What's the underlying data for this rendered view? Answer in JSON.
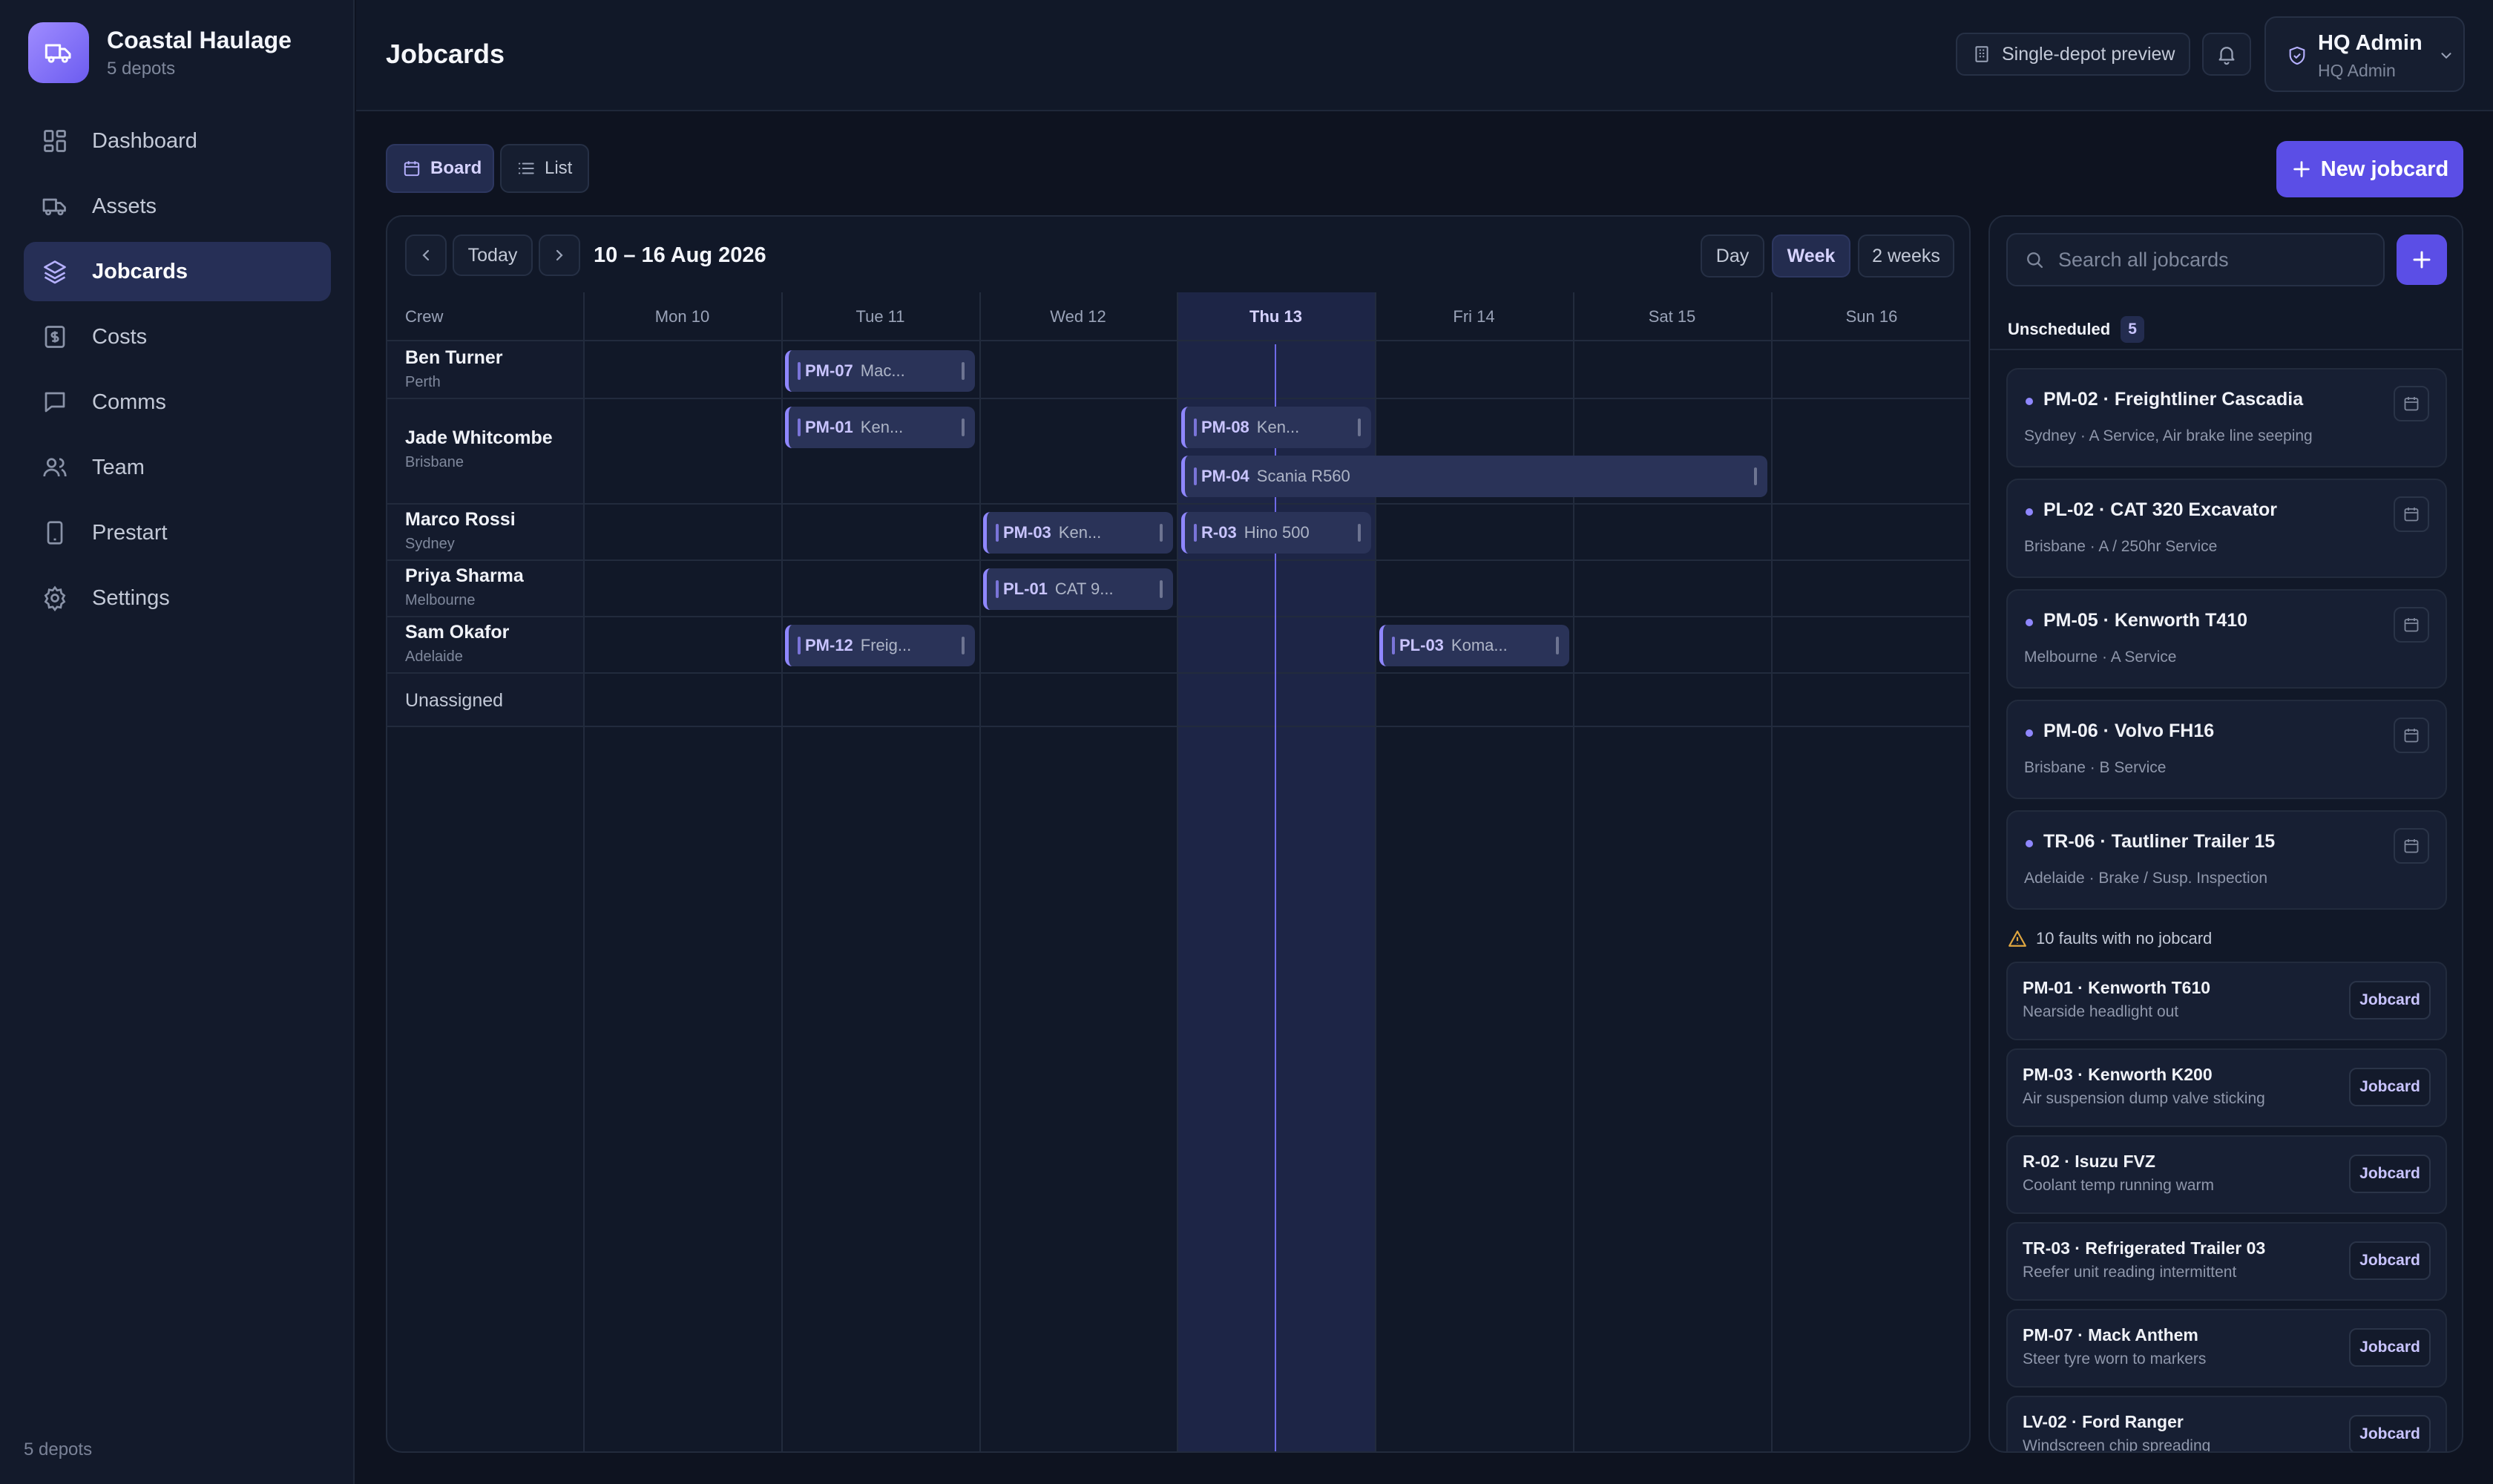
{
  "brand": {
    "name": "Coastal Haulage",
    "sub": "5 depots"
  },
  "nav": [
    {
      "label": "Dashboard",
      "icon": "dashboard-icon"
    },
    {
      "label": "Assets",
      "icon": "truck-icon"
    },
    {
      "label": "Jobcards",
      "icon": "layers-icon",
      "active": true
    },
    {
      "label": "Costs",
      "icon": "dollar-icon"
    },
    {
      "label": "Comms",
      "icon": "chat-icon"
    },
    {
      "label": "Team",
      "icon": "users-icon"
    },
    {
      "label": "Prestart",
      "icon": "phone-icon"
    },
    {
      "label": "Settings",
      "icon": "gear-icon"
    }
  ],
  "sidebar_footer": "5 depots",
  "header": {
    "title": "Jobcards",
    "preview_label": "Single-depot preview",
    "user_name": "HQ Admin",
    "user_role": "HQ Admin"
  },
  "toolbar": {
    "board": "Board",
    "list": "List",
    "new_jobcard": "New jobcard"
  },
  "calendar": {
    "today": "Today",
    "range": "10 – 16 Aug 2026",
    "day": "Day",
    "week": "Week",
    "two_weeks": "2 weeks",
    "crew_header": "Crew",
    "days": [
      "Mon 10",
      "Tue 11",
      "Wed 12",
      "Thu 13",
      "Fri 14",
      "Sat 15",
      "Sun 16"
    ],
    "today_index": 3,
    "crew": [
      {
        "name": "Ben Turner",
        "location": "Perth"
      },
      {
        "name": "Jade Whitcombe",
        "location": "Brisbane"
      },
      {
        "name": "Marco Rossi",
        "location": "Sydney"
      },
      {
        "name": "Priya Sharma",
        "location": "Melbourne"
      },
      {
        "name": "Sam Okafor",
        "location": "Adelaide"
      }
    ],
    "unassigned": "Unassigned",
    "jobs": [
      {
        "code": "PM-07",
        "label": "Mac..."
      },
      {
        "code": "PM-01",
        "label": "Ken..."
      },
      {
        "code": "PM-08",
        "label": "Ken..."
      },
      {
        "code": "PM-04",
        "label": "Scania R560"
      },
      {
        "code": "PM-03",
        "label": "Ken..."
      },
      {
        "code": "R-03",
        "label": "Hino 500"
      },
      {
        "code": "PL-01",
        "label": "CAT 9..."
      },
      {
        "code": "PM-12",
        "label": "Freig..."
      },
      {
        "code": "PL-03",
        "label": "Koma..."
      }
    ]
  },
  "panel": {
    "search_placeholder": "Search all jobcards",
    "unscheduled_label": "Unscheduled",
    "unscheduled_count": "5",
    "unscheduled": [
      {
        "title": "PM-02 · Freightliner Cascadia",
        "sub": "Sydney · A Service, Air brake line seeping"
      },
      {
        "title": "PL-02 · CAT 320 Excavator",
        "sub": "Brisbane · A / 250hr Service"
      },
      {
        "title": "PM-05 · Kenworth T410",
        "sub": "Melbourne · A Service"
      },
      {
        "title": "PM-06 · Volvo FH16",
        "sub": "Brisbane · B Service"
      },
      {
        "title": "TR-06 · Tautliner Trailer 15",
        "sub": "Adelaide · Brake / Susp. Inspection"
      }
    ],
    "faults_label": "10 faults with no jobcard",
    "jobcard_btn": "Jobcard",
    "faults": [
      {
        "title": "PM-01 · Kenworth T610",
        "sub": "Nearside headlight out"
      },
      {
        "title": "PM-03 · Kenworth K200",
        "sub": "Air suspension dump valve sticking"
      },
      {
        "title": "R-02 · Isuzu FVZ",
        "sub": "Coolant temp running warm"
      },
      {
        "title": "TR-03 · Refrigerated Trailer 03",
        "sub": "Reefer unit reading intermittent"
      },
      {
        "title": "PM-07 · Mack Anthem",
        "sub": "Steer tyre worn to markers"
      },
      {
        "title": "LV-02 · Ford Ranger",
        "sub": "Windscreen chip spreading"
      }
    ]
  },
  "colors": {
    "accent": "#5b4ee6",
    "today_column": "#1d2546",
    "job_border": "#8f87ff",
    "warning": "#e0a640"
  }
}
